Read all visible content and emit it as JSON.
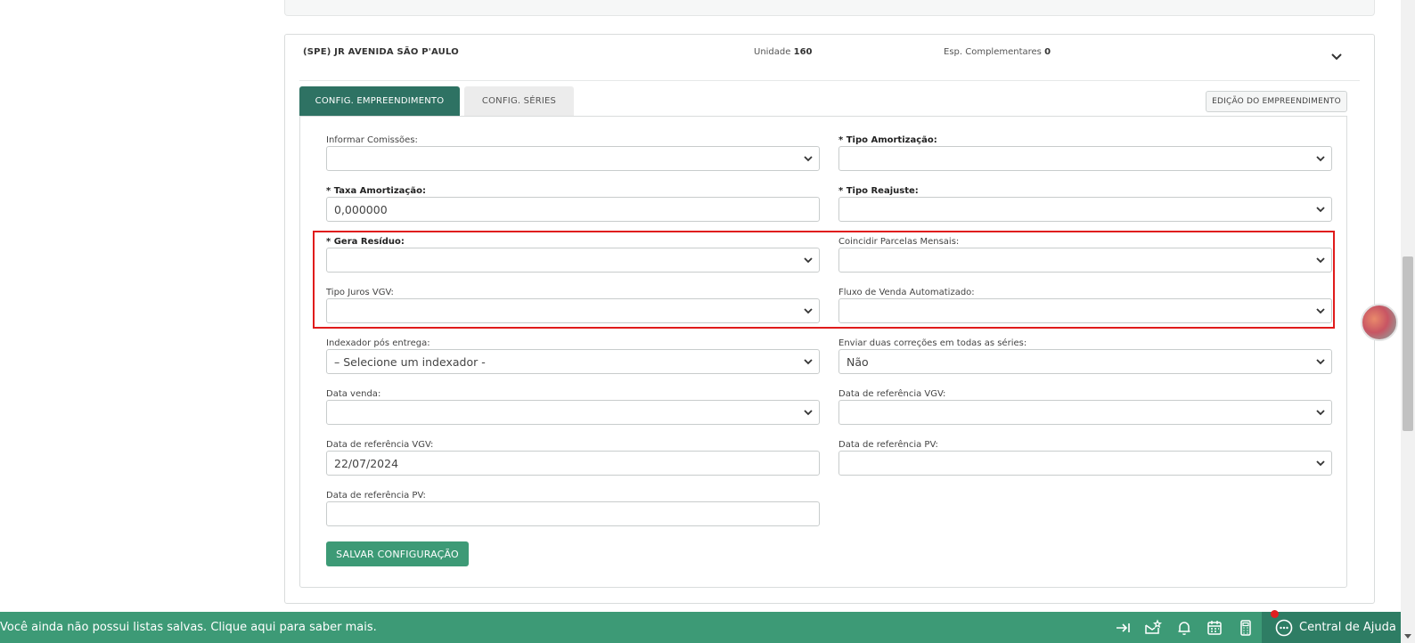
{
  "card": {
    "company": "(SPE) JR AVENIDA SÃO P'AULO",
    "unidade_label": "Unidade",
    "unidade_value": "160",
    "esp_label": "Esp. Complementares",
    "esp_value": "0"
  },
  "tabs": [
    {
      "label": "CONFIG. EMPREENDIMENTO",
      "active": true
    },
    {
      "label": "CONFIG. SÉRIES",
      "active": false
    }
  ],
  "edit_button": "EDIÇÃO DO EMPREENDIMENTO",
  "form": {
    "informar_comissoes": {
      "label": "Informar Comissões:",
      "value": ""
    },
    "tipo_amortizacao": {
      "label": "* Tipo Amortização:",
      "value": ""
    },
    "taxa_amortizacao": {
      "label": "* Taxa Amortização:",
      "value": "0,000000"
    },
    "tipo_reajuste": {
      "label": "* Tipo Reajuste:",
      "value": ""
    },
    "gera_residuo": {
      "label": "* Gera Resíduo:",
      "value": ""
    },
    "coincidir_parcelas": {
      "label": "Coincidir Parcelas Mensais:",
      "value": ""
    },
    "tipo_juros_vgv": {
      "label": "Tipo Juros VGV:",
      "value": ""
    },
    "fluxo_venda": {
      "label": "Fluxo de Venda Automatizado:",
      "value": ""
    },
    "indexador": {
      "label": "Indexador pós entrega:",
      "value": "– Selecione um indexador -"
    },
    "enviar_correcoes": {
      "label": "Enviar duas correções em todas as séries:",
      "value": "Não"
    },
    "data_venda": {
      "label": "Data venda:",
      "value": ""
    },
    "data_ref_vgv_select": {
      "label": "Data de referência VGV:",
      "value": ""
    },
    "data_ref_vgv_input": {
      "label": "Data de referência VGV:",
      "value": "22/07/2024"
    },
    "data_ref_pv_select": {
      "label": "Data de referência PV:",
      "value": ""
    },
    "data_ref_pv_input": {
      "label": "Data de referência PV:",
      "value": ""
    }
  },
  "save_button": "SALVAR CONFIGURAÇÃO",
  "bottom_bar": {
    "message": "Você ainda não possui listas salvas. Clique aqui para saber mais.",
    "help_label": "Central de Ajuda"
  },
  "colors": {
    "primary": "#2e7263",
    "accent": "#3d9a76",
    "highlight": "#e01b1b"
  }
}
